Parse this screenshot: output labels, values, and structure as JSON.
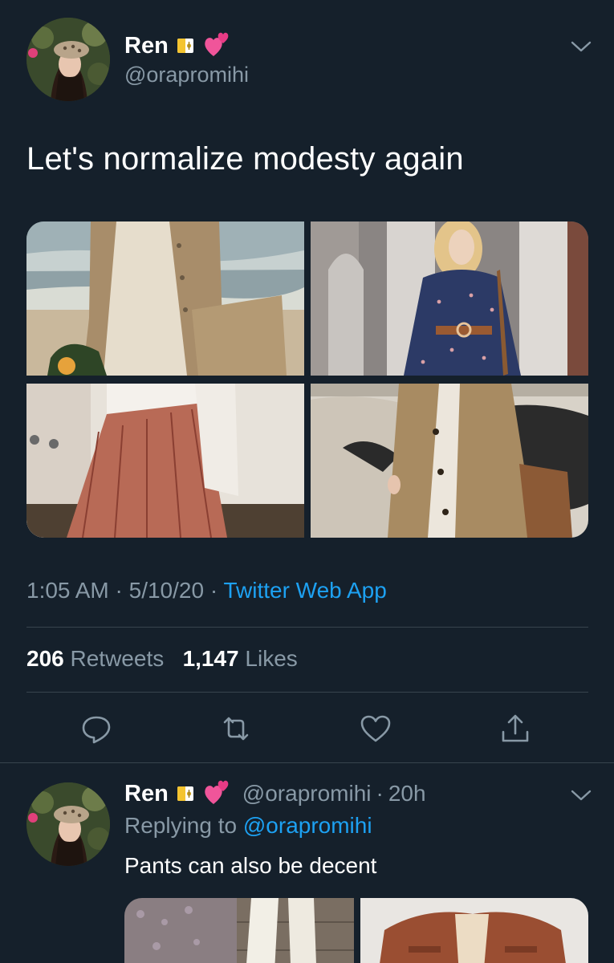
{
  "main_tweet": {
    "display_name": "Ren",
    "handle": "@orapromihi",
    "text": "Let's normalize modesty again",
    "images": [
      {
        "icon": "photo-beige-dress-beach"
      },
      {
        "icon": "photo-navy-floral-dress"
      },
      {
        "icon": "photo-floral-pleated-skirt"
      },
      {
        "icon": "photo-camel-trench-coat"
      }
    ],
    "time": "1:05 AM",
    "date": "5/10/20",
    "separator": "·",
    "source": "Twitter Web App",
    "retweets_count": "206",
    "retweets_label": "Retweets",
    "likes_count": "1,147",
    "likes_label": "Likes",
    "actions": [
      {
        "icon": "reply-icon"
      },
      {
        "icon": "retweet-icon"
      },
      {
        "icon": "like-heart-icon"
      },
      {
        "icon": "share-icon"
      }
    ]
  },
  "reply_tweet": {
    "display_name": "Ren",
    "handle": "@orapromihi",
    "separator": "·",
    "time": "20h",
    "replying_prefix": "Replying to",
    "replying_to": "@orapromihi",
    "text": "Pants can also be decent",
    "images": [
      {
        "icon": "photo-white-pants-cobblestone"
      },
      {
        "icon": "photo-rust-jacket"
      }
    ]
  },
  "colors": {
    "background": "#15202b",
    "primary_text": "#ffffff",
    "secondary_text": "#8899a6",
    "link": "#1da1f2",
    "divider": "#38444d"
  }
}
